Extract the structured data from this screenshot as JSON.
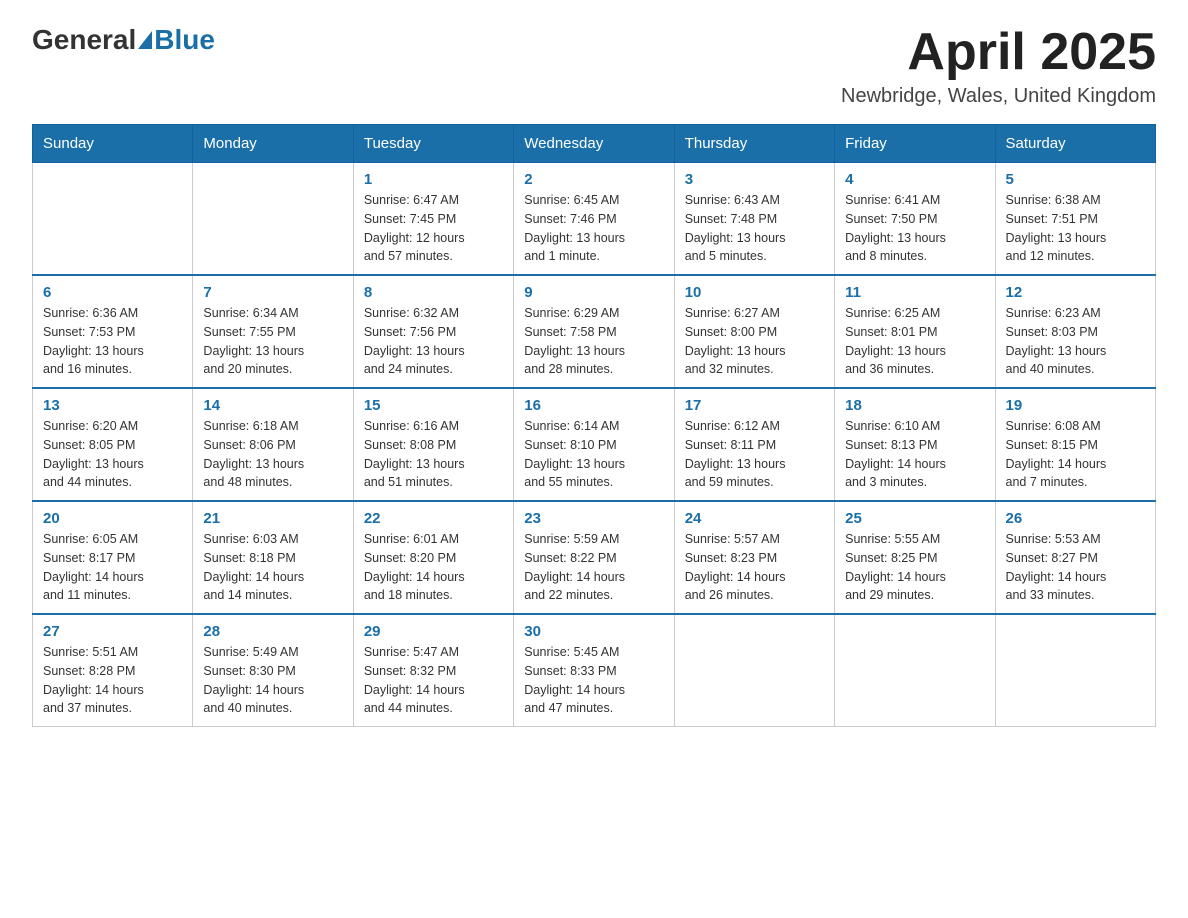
{
  "header": {
    "logo_general": "General",
    "logo_blue": "Blue",
    "month_title": "April 2025",
    "location": "Newbridge, Wales, United Kingdom"
  },
  "weekdays": [
    "Sunday",
    "Monday",
    "Tuesday",
    "Wednesday",
    "Thursday",
    "Friday",
    "Saturday"
  ],
  "weeks": [
    [
      {
        "day": "",
        "info": ""
      },
      {
        "day": "",
        "info": ""
      },
      {
        "day": "1",
        "info": "Sunrise: 6:47 AM\nSunset: 7:45 PM\nDaylight: 12 hours\nand 57 minutes."
      },
      {
        "day": "2",
        "info": "Sunrise: 6:45 AM\nSunset: 7:46 PM\nDaylight: 13 hours\nand 1 minute."
      },
      {
        "day": "3",
        "info": "Sunrise: 6:43 AM\nSunset: 7:48 PM\nDaylight: 13 hours\nand 5 minutes."
      },
      {
        "day": "4",
        "info": "Sunrise: 6:41 AM\nSunset: 7:50 PM\nDaylight: 13 hours\nand 8 minutes."
      },
      {
        "day": "5",
        "info": "Sunrise: 6:38 AM\nSunset: 7:51 PM\nDaylight: 13 hours\nand 12 minutes."
      }
    ],
    [
      {
        "day": "6",
        "info": "Sunrise: 6:36 AM\nSunset: 7:53 PM\nDaylight: 13 hours\nand 16 minutes."
      },
      {
        "day": "7",
        "info": "Sunrise: 6:34 AM\nSunset: 7:55 PM\nDaylight: 13 hours\nand 20 minutes."
      },
      {
        "day": "8",
        "info": "Sunrise: 6:32 AM\nSunset: 7:56 PM\nDaylight: 13 hours\nand 24 minutes."
      },
      {
        "day": "9",
        "info": "Sunrise: 6:29 AM\nSunset: 7:58 PM\nDaylight: 13 hours\nand 28 minutes."
      },
      {
        "day": "10",
        "info": "Sunrise: 6:27 AM\nSunset: 8:00 PM\nDaylight: 13 hours\nand 32 minutes."
      },
      {
        "day": "11",
        "info": "Sunrise: 6:25 AM\nSunset: 8:01 PM\nDaylight: 13 hours\nand 36 minutes."
      },
      {
        "day": "12",
        "info": "Sunrise: 6:23 AM\nSunset: 8:03 PM\nDaylight: 13 hours\nand 40 minutes."
      }
    ],
    [
      {
        "day": "13",
        "info": "Sunrise: 6:20 AM\nSunset: 8:05 PM\nDaylight: 13 hours\nand 44 minutes."
      },
      {
        "day": "14",
        "info": "Sunrise: 6:18 AM\nSunset: 8:06 PM\nDaylight: 13 hours\nand 48 minutes."
      },
      {
        "day": "15",
        "info": "Sunrise: 6:16 AM\nSunset: 8:08 PM\nDaylight: 13 hours\nand 51 minutes."
      },
      {
        "day": "16",
        "info": "Sunrise: 6:14 AM\nSunset: 8:10 PM\nDaylight: 13 hours\nand 55 minutes."
      },
      {
        "day": "17",
        "info": "Sunrise: 6:12 AM\nSunset: 8:11 PM\nDaylight: 13 hours\nand 59 minutes."
      },
      {
        "day": "18",
        "info": "Sunrise: 6:10 AM\nSunset: 8:13 PM\nDaylight: 14 hours\nand 3 minutes."
      },
      {
        "day": "19",
        "info": "Sunrise: 6:08 AM\nSunset: 8:15 PM\nDaylight: 14 hours\nand 7 minutes."
      }
    ],
    [
      {
        "day": "20",
        "info": "Sunrise: 6:05 AM\nSunset: 8:17 PM\nDaylight: 14 hours\nand 11 minutes."
      },
      {
        "day": "21",
        "info": "Sunrise: 6:03 AM\nSunset: 8:18 PM\nDaylight: 14 hours\nand 14 minutes."
      },
      {
        "day": "22",
        "info": "Sunrise: 6:01 AM\nSunset: 8:20 PM\nDaylight: 14 hours\nand 18 minutes."
      },
      {
        "day": "23",
        "info": "Sunrise: 5:59 AM\nSunset: 8:22 PM\nDaylight: 14 hours\nand 22 minutes."
      },
      {
        "day": "24",
        "info": "Sunrise: 5:57 AM\nSunset: 8:23 PM\nDaylight: 14 hours\nand 26 minutes."
      },
      {
        "day": "25",
        "info": "Sunrise: 5:55 AM\nSunset: 8:25 PM\nDaylight: 14 hours\nand 29 minutes."
      },
      {
        "day": "26",
        "info": "Sunrise: 5:53 AM\nSunset: 8:27 PM\nDaylight: 14 hours\nand 33 minutes."
      }
    ],
    [
      {
        "day": "27",
        "info": "Sunrise: 5:51 AM\nSunset: 8:28 PM\nDaylight: 14 hours\nand 37 minutes."
      },
      {
        "day": "28",
        "info": "Sunrise: 5:49 AM\nSunset: 8:30 PM\nDaylight: 14 hours\nand 40 minutes."
      },
      {
        "day": "29",
        "info": "Sunrise: 5:47 AM\nSunset: 8:32 PM\nDaylight: 14 hours\nand 44 minutes."
      },
      {
        "day": "30",
        "info": "Sunrise: 5:45 AM\nSunset: 8:33 PM\nDaylight: 14 hours\nand 47 minutes."
      },
      {
        "day": "",
        "info": ""
      },
      {
        "day": "",
        "info": ""
      },
      {
        "day": "",
        "info": ""
      }
    ]
  ]
}
